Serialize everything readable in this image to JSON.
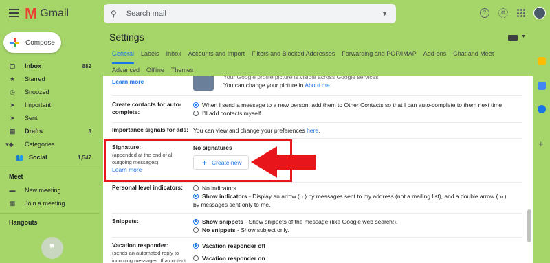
{
  "header": {
    "brand": "Gmail",
    "logo_letter": "M",
    "search_placeholder": "Search mail",
    "icons": [
      "menu-icon",
      "search-icon",
      "help-icon",
      "settings-gear-icon",
      "apps-grid-icon",
      "avatar"
    ]
  },
  "sidebar": {
    "compose_label": "Compose",
    "items": [
      {
        "label": "Inbox",
        "count": "882",
        "icon": "▢"
      },
      {
        "label": "Starred",
        "count": "",
        "icon": "★"
      },
      {
        "label": "Snoozed",
        "count": "",
        "icon": "◷"
      },
      {
        "label": "Important",
        "count": "",
        "icon": "➤"
      },
      {
        "label": "Sent",
        "count": "",
        "icon": "➤"
      },
      {
        "label": "Drafts",
        "count": "3",
        "icon": "▤"
      },
      {
        "label": "Categories",
        "count": "",
        "icon": "▾◆"
      },
      {
        "label": "Social",
        "count": "1,547",
        "icon": "👥"
      }
    ],
    "meet_title": "Meet",
    "meet_items": [
      {
        "label": "New meeting",
        "icon": "▬"
      },
      {
        "label": "Join a meeting",
        "icon": "▦"
      }
    ],
    "hangouts_title": "Hangouts",
    "hangouts_quote": "❞"
  },
  "settings": {
    "title": "Settings",
    "tabs_row1": [
      "General",
      "Labels",
      "Inbox",
      "Accounts and Import",
      "Filters and Blocked Addresses",
      "Forwarding and POP/IMAP",
      "Add-ons",
      "Chat and Meet"
    ],
    "tabs_row2": [
      "Advanced",
      "Offline",
      "Themes"
    ],
    "active_tab": "General"
  },
  "content": {
    "top_learn_more": "Learn more",
    "picture_text_cut": "Your Google profile picture is visible across Google services.",
    "picture_change_prefix": "You can change your picture in",
    "picture_change_link": "About me",
    "picture_change_suffix": ".",
    "contacts_label": "Create contacts for auto-complete:",
    "contacts_opt1": "When I send a message to a new person, add them to Other Contacts so that I can auto-complete to them next time",
    "contacts_opt2": "I'll add contacts myself",
    "importance_label": "Importance signals for ads:",
    "importance_text": "You can view and change your preferences",
    "importance_link": "here",
    "importance_suffix": ".",
    "signature_label": "Signature:",
    "signature_sub": "(appended at the end of all outgoing messages)",
    "signature_learn_more": "Learn more",
    "signature_none": "No signatures",
    "create_new": "Create new",
    "personal_label": "Personal level indicators:",
    "personal_opt1": "No indicators",
    "personal_opt2_bold": "Show indicators",
    "personal_opt2_text": " - Display an arrow ( › ) by messages sent to my address (not a mailing list), and a double arrow ( » ) by messages sent only to me.",
    "snippets_label": "Snippets:",
    "snippets_opt1_bold": "Show snippets",
    "snippets_opt1_text": " - Show snippets of the message (like Google web search!).",
    "snippets_opt2_bold": "No snippets",
    "snippets_opt2_text": " - Show subject only.",
    "vacation_label": "Vacation responder:",
    "vacation_sub": "(sends an automated reply to incoming messages. If a contact",
    "vacation_opt1": "Vacation responder off",
    "vacation_opt2": "Vacation responder on"
  },
  "colors": {
    "background": "#a6d66a",
    "accent": "#1a73e8",
    "highlight": "#e8151b"
  }
}
